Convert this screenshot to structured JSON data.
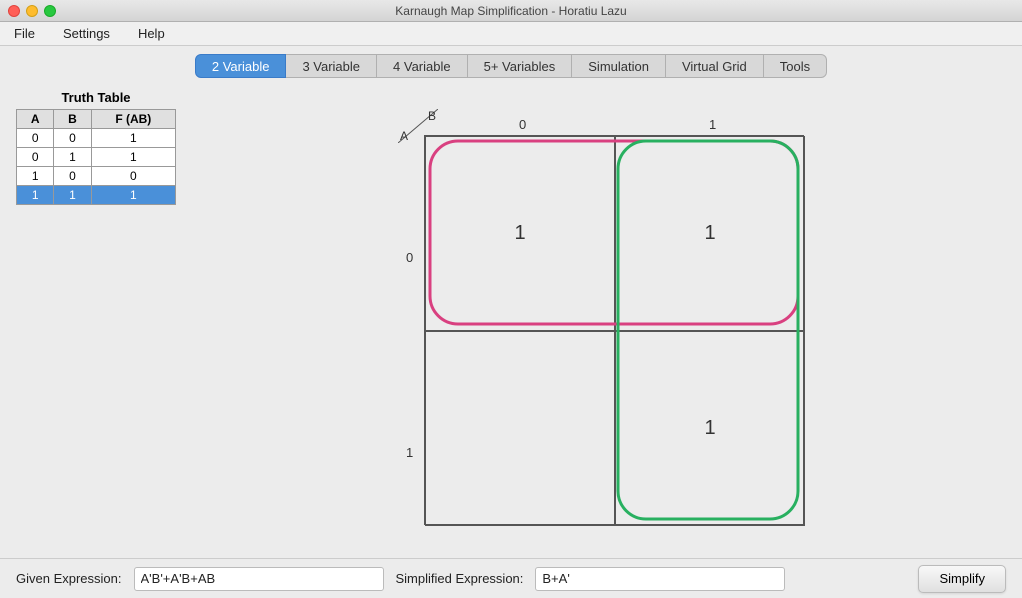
{
  "window": {
    "title": "Karnaugh Map Simplification - Horatiu Lazu"
  },
  "menu": {
    "items": [
      "File",
      "Settings",
      "Help"
    ]
  },
  "tabs": [
    {
      "label": "2 Variable",
      "active": true
    },
    {
      "label": "3 Variable",
      "active": false
    },
    {
      "label": "4 Variable",
      "active": false
    },
    {
      "label": "5+ Variables",
      "active": false
    },
    {
      "label": "Simulation",
      "active": false
    },
    {
      "label": "Virtual Grid",
      "active": false
    },
    {
      "label": "Tools",
      "active": false
    }
  ],
  "truth_table": {
    "title": "Truth Table",
    "headers": [
      "A",
      "B",
      "F (AB)"
    ],
    "rows": [
      {
        "a": "0",
        "b": "0",
        "f": "1",
        "highlighted": false
      },
      {
        "a": "0",
        "b": "1",
        "f": "1",
        "highlighted": false
      },
      {
        "a": "1",
        "b": "0",
        "f": "0",
        "highlighted": false
      },
      {
        "a": "1",
        "b": "1",
        "f": "1",
        "highlighted": true
      }
    ]
  },
  "kmap": {
    "label_b": "B",
    "label_a": "A",
    "col_labels": [
      "0",
      "1"
    ],
    "row_labels": [
      "0",
      "1"
    ],
    "diagonal_b": "B",
    "diagonal_a": "A",
    "cells": [
      {
        "row": 0,
        "col": 0,
        "value": "1"
      },
      {
        "row": 0,
        "col": 1,
        "value": "1"
      },
      {
        "row": 1,
        "col": 0,
        "value": ""
      },
      {
        "row": 1,
        "col": 1,
        "value": "1"
      }
    ]
  },
  "bottom": {
    "given_label": "Given Expression:",
    "given_value": "A'B'+A'B+AB",
    "simplified_label": "Simplified Expression:",
    "simplified_value": "B+A'",
    "simplify_button": "Simplify"
  }
}
